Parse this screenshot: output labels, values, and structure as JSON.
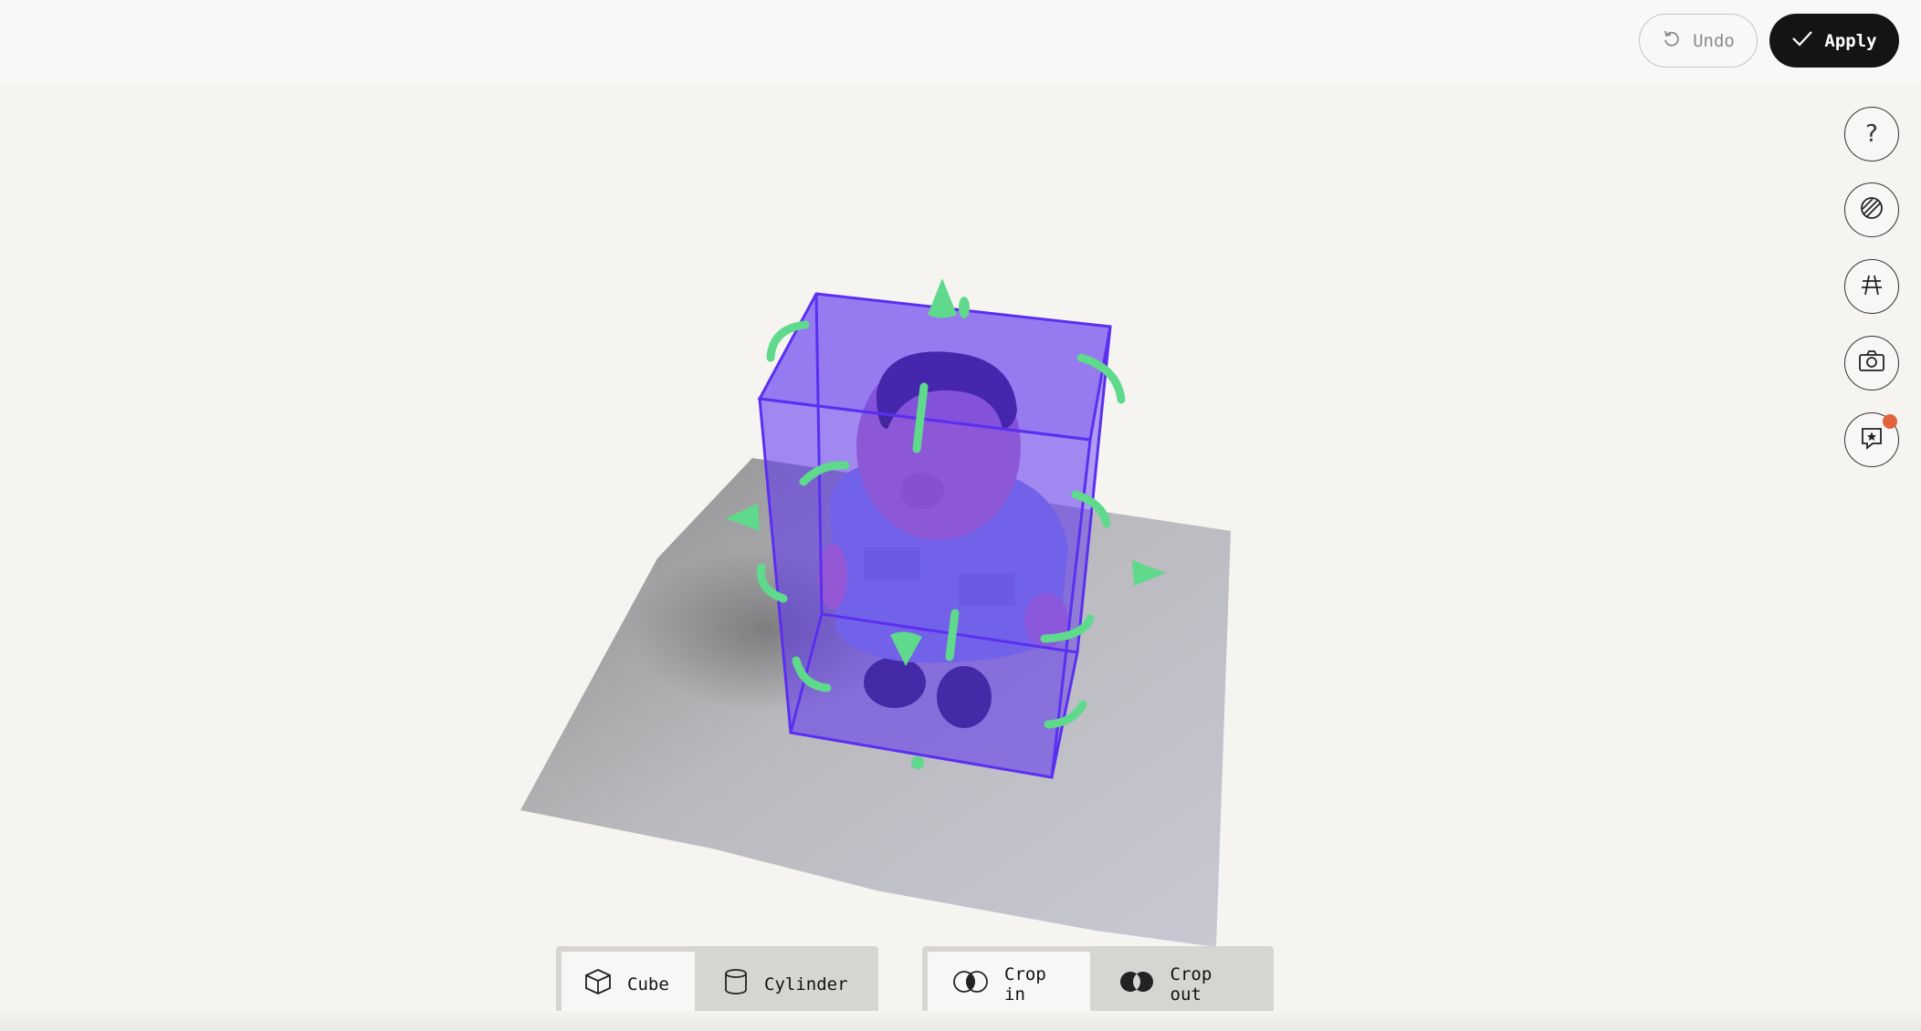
{
  "header": {
    "undo_label": "Undo",
    "apply_label": "Apply",
    "undo_icon": "undo-icon",
    "apply_icon": "check-icon"
  },
  "side_tools": [
    {
      "icon": "help-icon",
      "glyph": "?"
    },
    {
      "icon": "texture-icon"
    },
    {
      "icon": "grid-plane-icon"
    },
    {
      "icon": "camera-icon"
    },
    {
      "icon": "star-badge-icon",
      "has_notification": true
    }
  ],
  "shape_toolbar": {
    "cube_label": "Cube",
    "cylinder_label": "Cylinder",
    "selected": "Cube"
  },
  "crop_toolbar": {
    "crop_in_label": "Crop in",
    "crop_out_label": "Crop out",
    "selected": "Crop in"
  },
  "colors": {
    "bounding_box": "#5b2ff0",
    "gizmo": "#5fd98b",
    "notification": "#e3633f",
    "apply_bg": "#141414"
  }
}
